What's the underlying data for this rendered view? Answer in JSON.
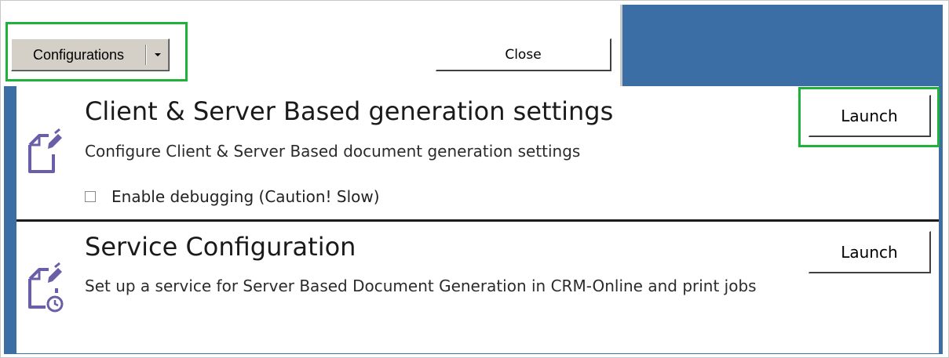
{
  "toolbar": {
    "configurations_label": "Configurations",
    "close_label": "Close"
  },
  "panels": [
    {
      "title": "Client & Server Based generation settings",
      "description": "Configure Client & Server Based document generation settings",
      "launch_label": "Launch",
      "checkbox_label": "Enable debugging (Caution! Slow)",
      "checkbox_checked": false,
      "icon": "document-edit-icon"
    },
    {
      "title": "Service Configuration",
      "description": "Set up a service for Server Based Document Generation in CRM-Online and print jobs",
      "launch_label": "Launch",
      "icon": "document-service-icon"
    }
  ],
  "colors": {
    "background_blue": "#3a6ea5",
    "highlight_green": "#1fb23b",
    "icon_purple": "#6b5ea8"
  }
}
